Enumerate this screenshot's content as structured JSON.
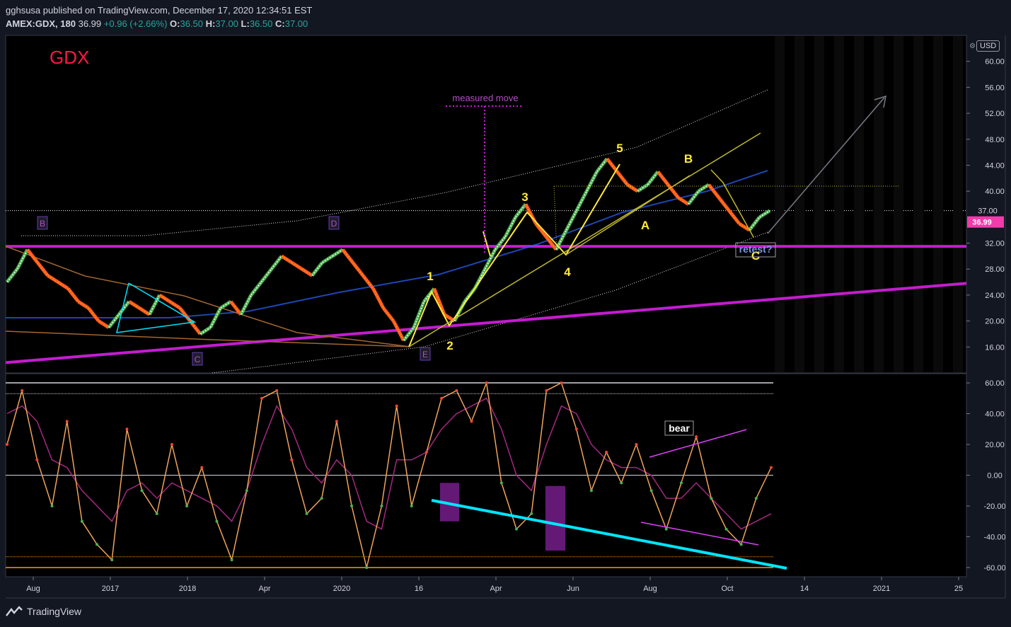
{
  "header": {
    "published": "gghsusa published on TradingView.com, December 17, 2020 12:34:51 EST",
    "symbol": "AMEX:GDX, 180",
    "last": "36.99",
    "change": "+0.96 (+2.66%)",
    "o_label": "O:",
    "o_val": "36.50",
    "h_label": "H:",
    "h_val": "37.00",
    "l_label": "L:",
    "l_val": "36.50",
    "c_label": "C:",
    "c_val": "37.00"
  },
  "currency": "USD",
  "footer": {
    "brand": "TradingView"
  },
  "colors": {
    "background": "#131722",
    "title": "#ff1744",
    "wave_labels": "#ffeb3b",
    "purple_line": "#c51bd1",
    "cyan": "#00e5ff",
    "last_price_badge": "#f23cab"
  },
  "chart_data": [
    {
      "type": "line",
      "title": "GDX",
      "y_ticks": [
        "60.00",
        "56.00",
        "52.00",
        "48.00",
        "44.00",
        "40.00",
        "37.00",
        "32.00",
        "28.00",
        "24.00",
        "20.00",
        "16.00"
      ],
      "ylim": [
        12,
        64
      ],
      "x_ticks": [
        "Aug",
        "2017",
        "2018",
        "Apr",
        "2020",
        "16",
        "Apr",
        "Jun",
        "Aug",
        "Oct",
        "14",
        "2021",
        "25"
      ],
      "last_price": "36.99",
      "series": [
        {
          "values": [
            26,
            28,
            31,
            29,
            27,
            26,
            25,
            23,
            22,
            20,
            19,
            21,
            23,
            22,
            21,
            24,
            23,
            22,
            20,
            18,
            19,
            22,
            23,
            21,
            24,
            26,
            28,
            30,
            29,
            28,
            27,
            29,
            30,
            31,
            29,
            27,
            25,
            22,
            20,
            17,
            19,
            23,
            25,
            21,
            20,
            23,
            25,
            28,
            31,
            33,
            36,
            38,
            35,
            33,
            31,
            34,
            37,
            40,
            43,
            45,
            43,
            41,
            40,
            41,
            43,
            41,
            39,
            38,
            40,
            41,
            39,
            37,
            35,
            34,
            36,
            37
          ]
        }
      ],
      "annotations": [
        "measured move",
        "1",
        "2",
        "3",
        "4",
        "5",
        "A",
        "B",
        "C",
        "retest?"
      ],
      "box_labels": [
        "B",
        "C",
        "D",
        "E"
      ]
    },
    {
      "type": "line",
      "y_ticks": [
        "60.00",
        "40.00",
        "20.00",
        "0.00",
        "-20.00",
        "-40.00",
        "-60.00"
      ],
      "ylim": [
        -66,
        66
      ],
      "annotations": [
        "bear"
      ],
      "series": [
        {
          "values": [
            20,
            55,
            10,
            -20,
            35,
            -30,
            -45,
            -55,
            30,
            -10,
            -25,
            20,
            -20,
            5,
            -30,
            -55,
            -10,
            50,
            55,
            10,
            -25,
            -15,
            35,
            -20,
            -60,
            -20,
            45,
            -20,
            15,
            50,
            55,
            35,
            60,
            -5,
            -35,
            -25,
            55,
            60,
            30,
            -10,
            15,
            -5,
            20,
            -10,
            -35,
            -5,
            25,
            -15,
            -35,
            -45,
            -15,
            5
          ]
        },
        {
          "values": [
            40,
            45,
            35,
            10,
            5,
            -10,
            -20,
            -30,
            -10,
            -5,
            -15,
            -5,
            -10,
            -15,
            -20,
            -30,
            -10,
            20,
            45,
            30,
            5,
            -5,
            10,
            0,
            -30,
            -35,
            10,
            10,
            15,
            30,
            40,
            45,
            50,
            30,
            0,
            -10,
            20,
            45,
            40,
            20,
            10,
            5,
            5,
            0,
            -15,
            -15,
            -5,
            -15,
            -25,
            -35,
            -30,
            -25
          ]
        }
      ]
    }
  ]
}
